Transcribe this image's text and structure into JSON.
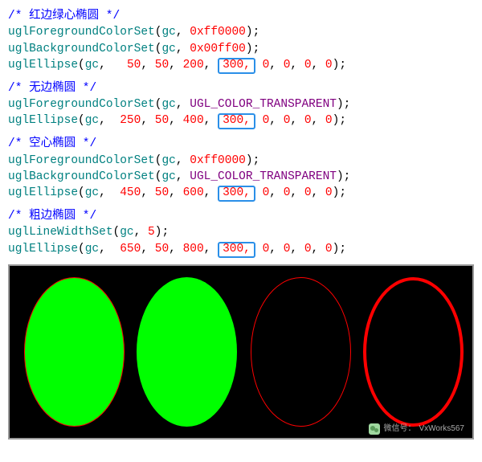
{
  "blocks": [
    {
      "comment": "/* 红边绿心椭圆 */",
      "lines": [
        {
          "fn": "uglForegroundColorSet",
          "var": "gc",
          "args_html": "<span class='num'>0xff0000</span>"
        },
        {
          "fn": "uglBackgroundColorSet",
          "var": "gc",
          "args_html": "<span class='num'>0x00ff00</span>"
        },
        {
          "fn": "uglEllipse",
          "var": "gc",
          "args_html": "  <span class='num'>50</span>, <span class='num'>50</span>, <span class='num'>200</span>, <span class='boxed'>300,</span> <span class='num'>0</span>, <span class='num'>0</span>, <span class='num'>0</span>, <span class='num'>0</span>"
        }
      ]
    },
    {
      "comment": "/* 无边椭圆 */",
      "lines": [
        {
          "fn": "uglForegroundColorSet",
          "var": "gc",
          "args_html": "<span class='ident'>UGL_COLOR_TRANSPARENT</span>"
        },
        {
          "fn": "uglEllipse",
          "var": "gc",
          "args_html": " <span class='num'>250</span>, <span class='num'>50</span>, <span class='num'>400</span>, <span class='boxed'>300,</span> <span class='num'>0</span>, <span class='num'>0</span>, <span class='num'>0</span>, <span class='num'>0</span>"
        }
      ]
    },
    {
      "comment": "/* 空心椭圆 */",
      "lines": [
        {
          "fn": "uglForegroundColorSet",
          "var": "gc",
          "args_html": "<span class='num'>0xff0000</span>"
        },
        {
          "fn": "uglBackgroundColorSet",
          "var": "gc",
          "args_html": "<span class='ident'>UGL_COLOR_TRANSPARENT</span>"
        },
        {
          "fn": "uglEllipse",
          "var": "gc",
          "args_html": " <span class='num'>450</span>, <span class='num'>50</span>, <span class='num'>600</span>, <span class='boxed'>300,</span> <span class='num'>0</span>, <span class='num'>0</span>, <span class='num'>0</span>, <span class='num'>0</span>"
        }
      ]
    },
    {
      "comment": "/* 粗边椭圆 */",
      "lines": [
        {
          "fn": "uglLineWidthSet",
          "var": "gc",
          "args_html": "<span class='num'>5</span>"
        },
        {
          "fn": "uglEllipse",
          "var": "gc",
          "args_html": " <span class='num'>650</span>, <span class='num'>50</span>, <span class='num'>800</span>, <span class='boxed'>300,</span> <span class='num'>0</span>, <span class='num'>0</span>, <span class='num'>0</span>, <span class='num'>0</span>"
        }
      ]
    }
  ],
  "footer": {
    "label": "微信号：",
    "value": "VxWorks567"
  },
  "chart_data": {
    "type": "diagram",
    "description": "Four ellipses rendered on black canvas showing foreground/background color and line width effects",
    "canvas_bg": "#000000",
    "shapes": [
      {
        "name": "红边绿心椭圆",
        "fill": "#00ff00",
        "stroke": "#ff0000",
        "stroke_width": 1
      },
      {
        "name": "无边椭圆",
        "fill": "#00ff00",
        "stroke": "transparent",
        "stroke_width": 0
      },
      {
        "name": "空心椭圆",
        "fill": "transparent",
        "stroke": "#ff0000",
        "stroke_width": 1
      },
      {
        "name": "粗边椭圆",
        "fill": "transparent",
        "stroke": "#ff0000",
        "stroke_width": 5
      }
    ]
  }
}
